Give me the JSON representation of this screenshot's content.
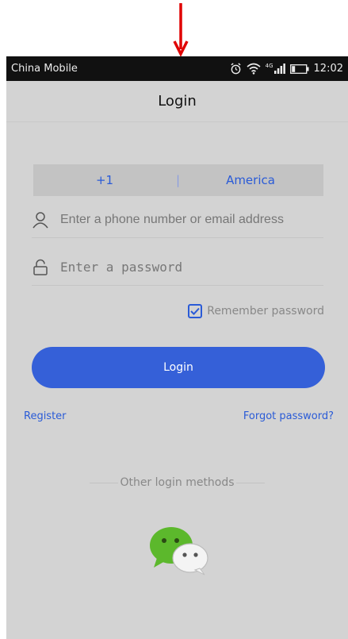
{
  "status_bar": {
    "carrier": "China Mobile",
    "network": "4G",
    "time": "12:02",
    "icons": [
      "alarm-icon",
      "wifi-icon",
      "signal-icon",
      "battery-icon"
    ]
  },
  "header": {
    "title": "Login"
  },
  "country": {
    "code": "+1",
    "separator": "|",
    "name": "America"
  },
  "phone_field": {
    "placeholder": "Enter a phone number or email address"
  },
  "password_field": {
    "placeholder": "Enter a password"
  },
  "remember": {
    "label": "Remember password",
    "checked": true
  },
  "login_button": {
    "label": "Login"
  },
  "links": {
    "register": "Register",
    "forgot": "Forgot password?"
  },
  "other_methods": {
    "label": "Other login methods"
  },
  "colors": {
    "accent": "#3560d8",
    "background": "#d3d3d3",
    "annotation": "#e00000"
  }
}
